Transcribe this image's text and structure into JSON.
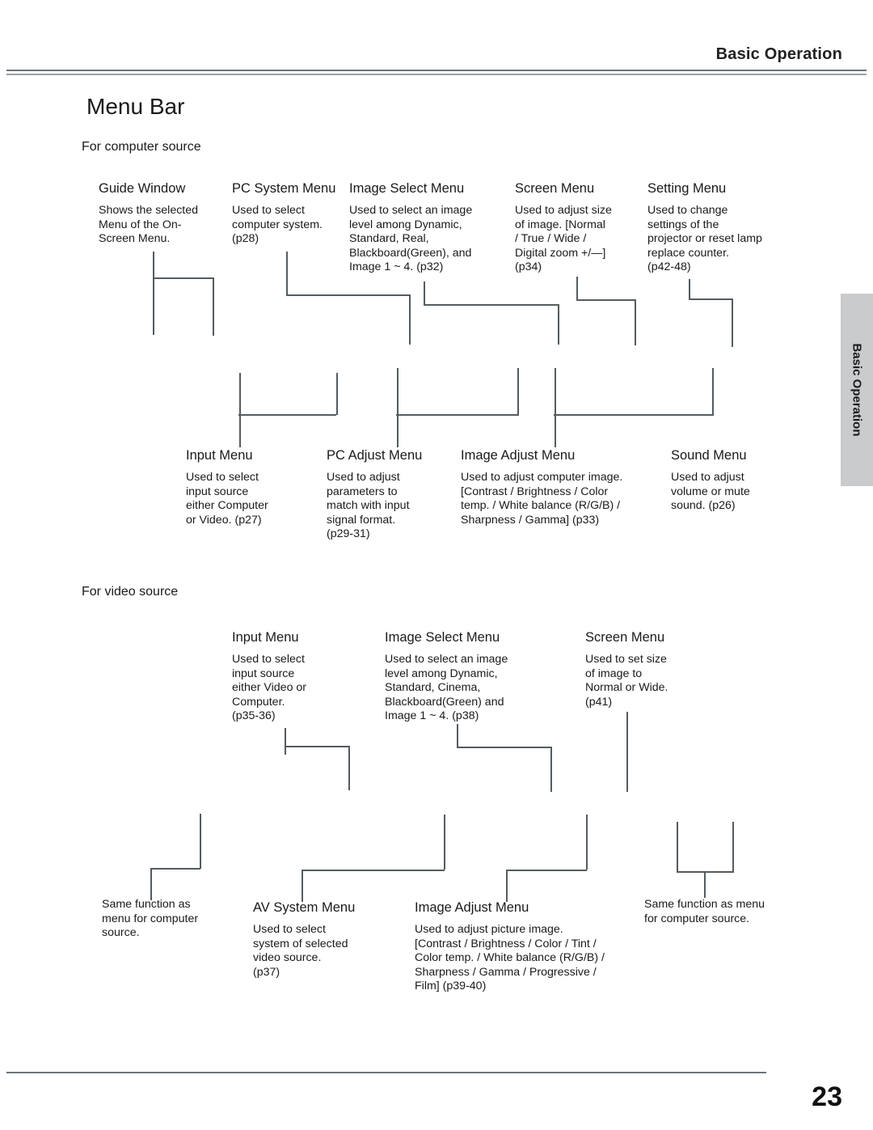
{
  "header": {
    "running_head": "Basic Operation",
    "section_title": "Menu Bar",
    "page_number": "23"
  },
  "side_tab": {
    "label": "Basic Operation"
  },
  "computer_section": {
    "heading": "For computer source",
    "row1": [
      {
        "title": "Guide Window",
        "body": "Shows the selected\nMenu of the On-\nScreen Menu."
      },
      {
        "title": "PC System Menu",
        "body": "Used to select\ncomputer system.\n(p28)"
      },
      {
        "title": "Image Select Menu",
        "body": "Used to select  an image\nlevel among Dynamic,\nStandard, Real,\nBlackboard(Green), and\nImage 1 ~ 4.  (p32)"
      },
      {
        "title": "Screen Menu",
        "body": "Used to adjust size\nof image.  [Normal\n/ True / Wide /\nDigital zoom +/—]\n(p34)"
      },
      {
        "title": "Setting Menu",
        "body": "Used to change\nsettings of the\nprojector or reset  lamp\nreplace counter.\n(p42-48)"
      }
    ],
    "row2": [
      {
        "title": "Input Menu",
        "body": "Used to select\ninput source\neither Computer\nor Video.  (p27)"
      },
      {
        "title": "PC Adjust Menu",
        "body": "Used to adjust\nparameters to\nmatch with input\nsignal format.\n(p29-31)"
      },
      {
        "title": "Image Adjust Menu",
        "body": "Used to adjust computer image.\n[Contrast / Brightness / Color\ntemp. /  White balance (R/G/B) /\nSharpness /  Gamma]   (p33)"
      },
      {
        "title": "Sound Menu",
        "body": "Used to adjust\nvolume or mute\nsound.  (p26)"
      }
    ]
  },
  "video_section": {
    "heading": "For video source",
    "row1": [
      {
        "title": "Input Menu",
        "body": "Used to select\ninput source\neither Video or\nComputer.\n(p35-36)"
      },
      {
        "title": "Image Select Menu",
        "body": "Used to select an image\nlevel among Dynamic,\nStandard, Cinema,\nBlackboard(Green) and\nImage 1 ~ 4.  (p38)"
      },
      {
        "title": "Screen Menu",
        "body": "Used to set size\nof image to\nNormal or Wide.\n(p41)"
      }
    ],
    "row2": [
      {
        "title": "",
        "body": "Same function as\nmenu for computer\nsource."
      },
      {
        "title": "AV System Menu",
        "body": "Used to select\nsystem of selected\nvideo source.\n(p37)"
      },
      {
        "title": "Image Adjust Menu",
        "body": " Used to adjust picture image.\n[Contrast / Brightness / Color / Tint /\nColor temp. / White balance (R/G/B) /\nSharpness / Gamma / Progressive /\nFilm]  (p39-40)"
      },
      {
        "title": "",
        "body": "Same function as menu\nfor computer source."
      }
    ]
  },
  "colors": {
    "rule": "#6d7479",
    "connector": "#555b5f",
    "side_tab_bg": "#c9cbcd"
  }
}
